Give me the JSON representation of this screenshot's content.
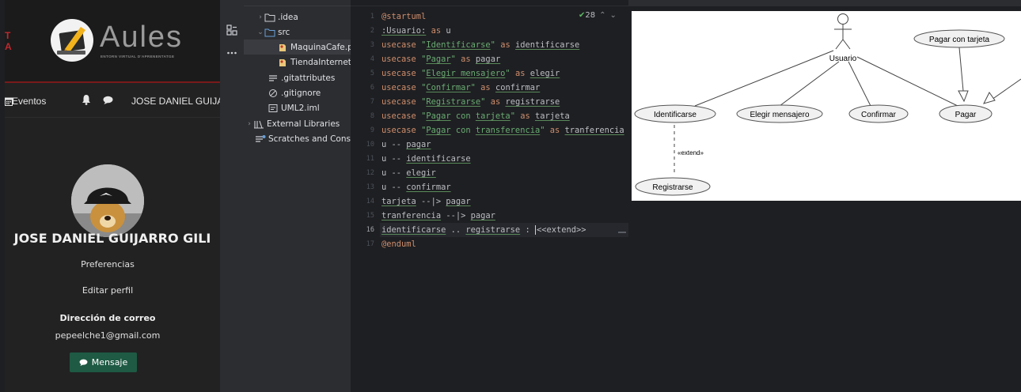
{
  "aules": {
    "logo_title": "Aules",
    "logo_subtitle": "ENTORN VIRTUAL D'APRENENTATGE",
    "nav_events": "Eventos",
    "nav_user": "JOSE DANIEL GUIJARRO",
    "profile_name": "JOSE DANIEL GUIJARRO GILI",
    "link_preferences": "Preferencias",
    "link_edit_profile": "Editar perfil",
    "email_heading": "Dirección de correo",
    "email": "pepeelche1@gmail.com",
    "message_button": "Mensaje",
    "colors": {
      "accent_red": "#c0282e",
      "button_green": "#1e5a44"
    }
  },
  "project_tree": [
    {
      "label": ".idea",
      "icon": "folder-icon",
      "chevron": "›"
    },
    {
      "label": "src",
      "icon": "folder-icon",
      "chevron": "⌄"
    },
    {
      "label": "MaquinaCafe.pu",
      "icon": "plantuml-file-icon",
      "chevron": ""
    },
    {
      "label": "TiendaInternet.p",
      "icon": "plantuml-file-icon",
      "chevron": ""
    },
    {
      "label": ".gitattributes",
      "icon": "gitattributes-icon",
      "chevron": ""
    },
    {
      "label": ".gitignore",
      "icon": "gitignore-icon",
      "chevron": ""
    },
    {
      "label": "UML2.iml",
      "icon": "iml-file-icon",
      "chevron": ""
    },
    {
      "label": "External Libraries",
      "icon": "library-icon",
      "chevron": "›"
    },
    {
      "label": "Scratches and Consol",
      "icon": "scratches-icon",
      "chevron": ""
    }
  ],
  "editor": {
    "inspection_count": "28",
    "current_line": 16,
    "line_numbers": [
      "1",
      "2",
      "3",
      "4",
      "5",
      "6",
      "7",
      "8",
      "9",
      "10",
      "11",
      "12",
      "13",
      "14",
      "15",
      "16",
      "17"
    ]
  },
  "diagram": {
    "actor": "Usuario",
    "use_cases": [
      "Identificarse",
      "Elegir mensajero",
      "Confirmar",
      "Pagar",
      "Pagar con tarjeta",
      "Registrarse"
    ],
    "extend_label": "«extend»"
  }
}
